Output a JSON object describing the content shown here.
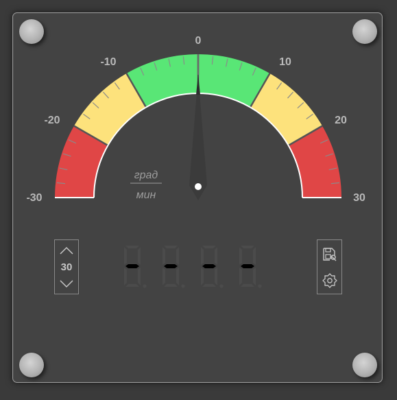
{
  "gauge": {
    "min": -30,
    "max": 30,
    "value": 0,
    "tick_labels": [
      "-30",
      "-20",
      "-10",
      "0",
      "10",
      "20",
      "30"
    ],
    "unit_top": "град",
    "unit_bottom": "мин",
    "zones": [
      {
        "from": -30,
        "to": -20,
        "color": "#e04646"
      },
      {
        "from": -20,
        "to": -10,
        "color": "#fde27c"
      },
      {
        "from": -10,
        "to": 10,
        "color": "#59e676"
      },
      {
        "from": 10,
        "to": 20,
        "color": "#fde27c"
      },
      {
        "from": 20,
        "to": 30,
        "color": "#e04646"
      }
    ]
  },
  "stepper": {
    "value": "30",
    "up_icon": "chevron-up-icon",
    "down_icon": "chevron-down-icon"
  },
  "display": {
    "digits": [
      "-",
      "-",
      "-",
      "-"
    ]
  },
  "toolbox": {
    "save_icon": "save-settings-icon",
    "settings_icon": "gear-icon"
  },
  "colors": {
    "panel": "#434343",
    "segment_on": "#000000",
    "segment_off": "#4b4b4b"
  }
}
